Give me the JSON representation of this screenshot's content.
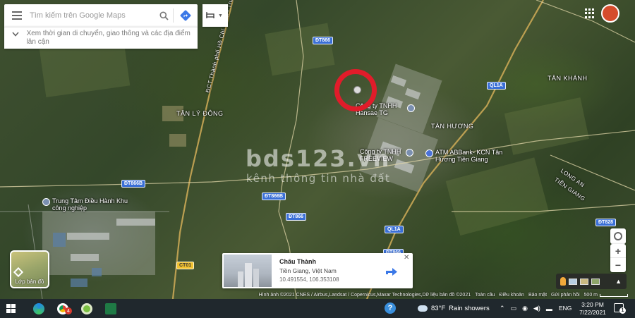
{
  "search": {
    "placeholder": "Tìm kiếm trên Google Maps",
    "hint": "Xem thời gian di chuyển, giao thông và các địa điểm lân cận"
  },
  "side_button_icon": "hotel-icon",
  "map": {
    "areas": [
      "TÂN LÝ ĐÔNG",
      "TÂN HƯƠNG",
      "TÂN KHÁNH",
      "LONG AN",
      "TIỀN GIANG"
    ],
    "road_vertical_label": "ĐCT.Thành phố Hồ Chí Minh - Trung Lương",
    "roads": [
      "ĐT866",
      "QL1A",
      "ĐT866B",
      "ĐT866B",
      "ĐT866",
      "QL1A",
      "CT01",
      "ĐT866",
      "ĐT828"
    ],
    "pois": [
      {
        "name": "Công ty TNHH Hansae TG",
        "icon": "place-pin-icon"
      },
      {
        "name": "Công ty TNHH FREEVIEW",
        "icon": "place-pin-icon"
      },
      {
        "name": "ATM ABBank- KCN Tân Hương Tiền Giang",
        "icon": "atm-pin-icon"
      },
      {
        "name": "Trung Tâm Điều Hành Khu công nghiệp",
        "icon": "place-pin-icon"
      }
    ],
    "highlight_color": "#e11c2a"
  },
  "watermark": {
    "title": "bds123.vn",
    "subtitle": "kênh thông tin nhà đất"
  },
  "layer_button": {
    "label": "Lớp bản đồ"
  },
  "place_card": {
    "name": "Châu Thành",
    "region": "Tiền Giang, Việt Nam",
    "coords": "10.491554, 106.353108"
  },
  "attribution": {
    "imagery": "Hình ảnh ©2021 CNES / Airbus,Landsat / Copernicus,Maxar Technologies,Dữ liệu bản đồ ©2021",
    "links": [
      "Toàn cầu",
      "Điều khoản",
      "Bảo mật",
      "Gửi phản hồi"
    ],
    "scale": "500 m"
  },
  "taskbar": {
    "badge_count": "4",
    "weather_temp": "83°F",
    "weather_desc": "Rain showers",
    "language": "ENG",
    "time": "3:20 PM",
    "date": "7/22/2021",
    "notification_count": "1"
  }
}
